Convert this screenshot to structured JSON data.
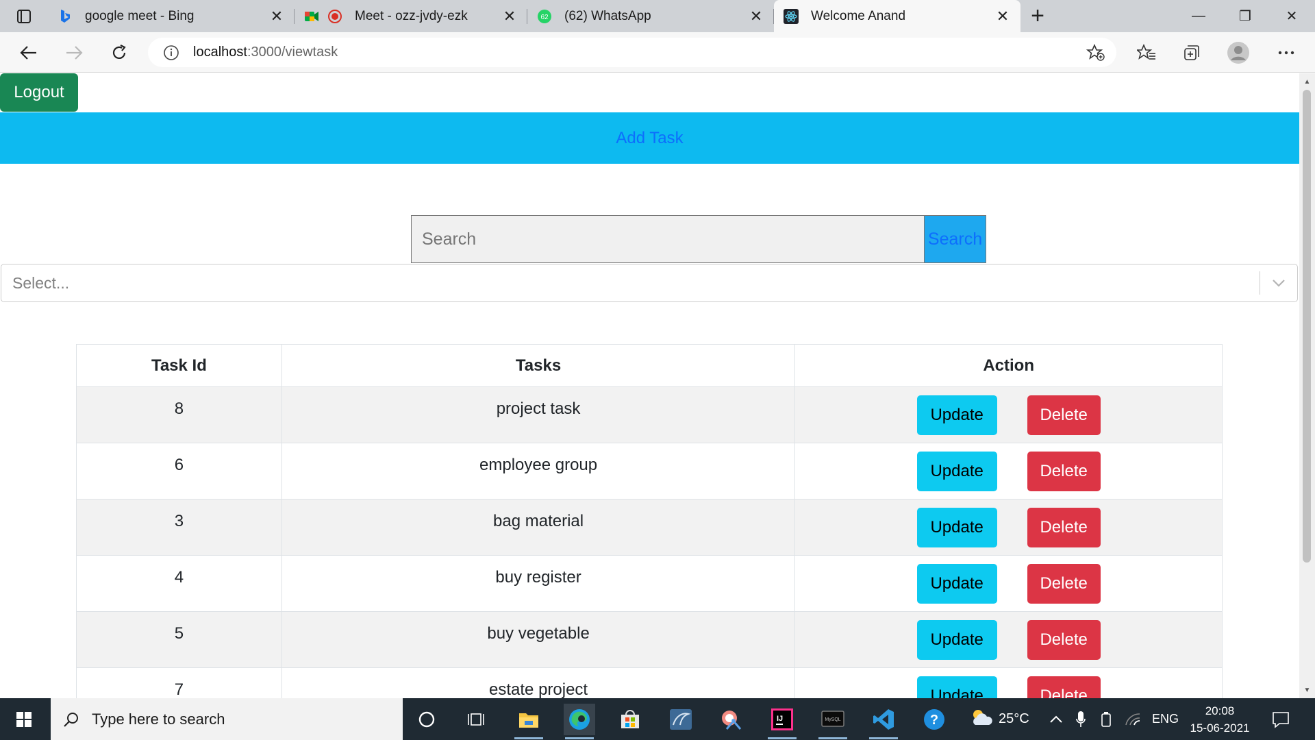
{
  "browser": {
    "tabs": [
      {
        "label": "google meet - Bing",
        "icon": "bing-icon",
        "active": false
      },
      {
        "label": "Meet - ozz-jvdy-ezk",
        "icon": "google-meet-icon",
        "active": false
      },
      {
        "label": "(62) WhatsApp",
        "icon": "whatsapp-icon",
        "badge": "62",
        "active": false
      },
      {
        "label": "Welcome Anand",
        "icon": "react-icon",
        "active": true
      }
    ],
    "url_host": "localhost",
    "url_path": ":3000/viewtask"
  },
  "page": {
    "logout_label": "Logout",
    "add_task_label": "Add Task",
    "search": {
      "placeholder": "Search",
      "value": "",
      "button_label": "Search"
    },
    "select": {
      "placeholder": "Select..."
    },
    "table": {
      "headers": [
        "Task Id",
        "Tasks",
        "Action"
      ],
      "update_label": "Update",
      "delete_label": "Delete",
      "rows": [
        {
          "id": "8",
          "task": "project task"
        },
        {
          "id": "6",
          "task": "employee group"
        },
        {
          "id": "3",
          "task": "bag material"
        },
        {
          "id": "4",
          "task": "buy register"
        },
        {
          "id": "5",
          "task": "buy vegetable"
        },
        {
          "id": "7",
          "task": "estate project"
        }
      ]
    }
  },
  "taskbar": {
    "search_placeholder": "Type here to search",
    "temperature": "25°C",
    "language": "ENG",
    "time": "20:08",
    "date": "15-06-2021"
  },
  "colors": {
    "logout": "#198754",
    "add_task_bar": "#0dbaf0",
    "link": "#0d6efd",
    "update": "#0dcaf0",
    "delete": "#dc3545"
  }
}
